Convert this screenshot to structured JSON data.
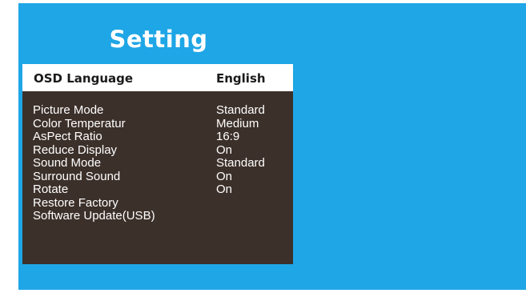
{
  "title": "Setting",
  "selected": {
    "label": "OSD Language",
    "value": "English"
  },
  "items": [
    {
      "label": "Picture Mode",
      "value": "Standard"
    },
    {
      "label": "Color Temperatur",
      "value": "Medium"
    },
    {
      "label": "AsPect Ratio",
      "value": "16:9"
    },
    {
      "label": "Reduce Display",
      "value": "On"
    },
    {
      "label": "Sound Mode",
      "value": "Standard"
    },
    {
      "label": "Surround Sound",
      "value": "On"
    },
    {
      "label": "Rotate",
      "value": "On"
    },
    {
      "label": "Restore Factory",
      "value": ""
    },
    {
      "label": "Software Update(USB)",
      "value": ""
    }
  ],
  "colors": {
    "background": "#1ea6e6",
    "menu_panel": "#3c302a",
    "highlight": "#ffffff"
  }
}
